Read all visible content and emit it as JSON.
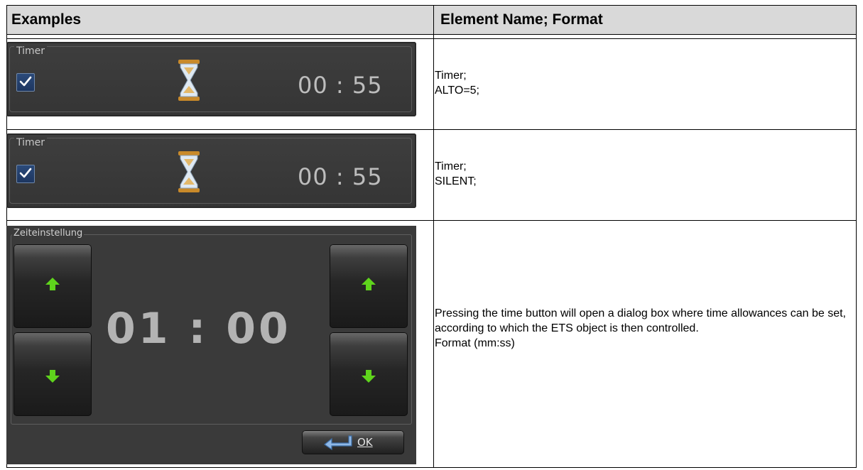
{
  "header": {
    "col1": "Examples",
    "col2": "Element Name; Format"
  },
  "rows": [
    {
      "widget": {
        "legend": "Timer",
        "checked": true,
        "icon": "hourglass-icon",
        "value": "00 : 55"
      },
      "description": "Timer;\nALTO=5;"
    },
    {
      "widget": {
        "legend": "Timer",
        "checked": true,
        "icon": "hourglass-icon",
        "value": "00 : 55"
      },
      "description": "Timer;\nSILENT;"
    },
    {
      "dialog": {
        "legend": "Zeiteinstellung",
        "time": "01 : 00",
        "ok_label": "OK",
        "up_icon": "arrow-up-icon",
        "down_icon": "arrow-down-icon",
        "ok_icon": "enter-icon"
      },
      "description": "Pressing the time button will open a dialog box where time allowances can be set, according to which the ETS object is then controlled.\nFormat (mm:ss)"
    }
  ],
  "colors": {
    "header_bg": "#d9d9d9",
    "widget_bg": "#3a3a3a",
    "checkbox": "#2b4a7a",
    "arrow_green": "#5fd41c"
  }
}
